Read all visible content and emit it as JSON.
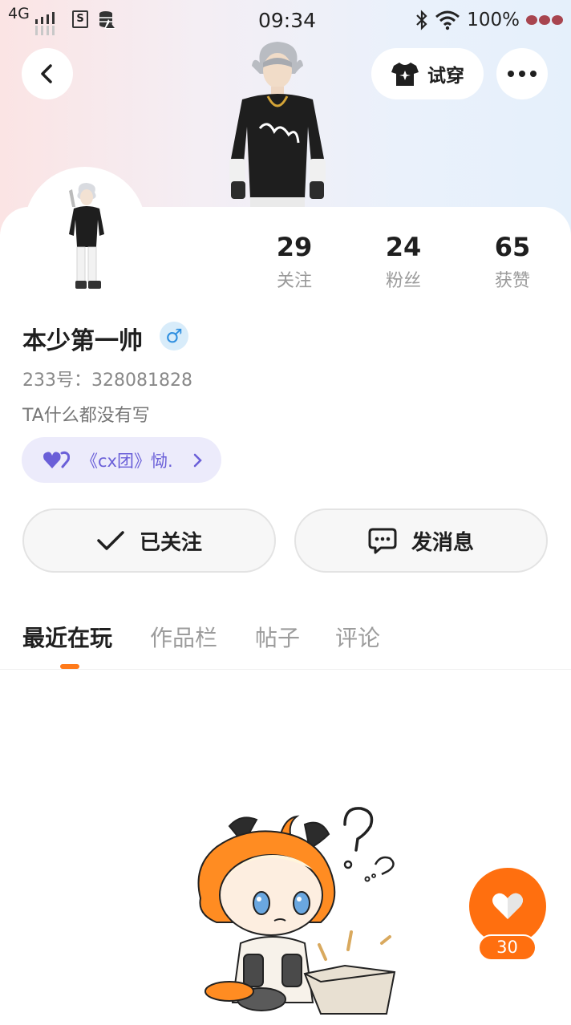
{
  "status_bar": {
    "network": "4G",
    "time": "09:34",
    "battery": "100%",
    "icons": [
      "signal-icon",
      "note-icon",
      "database-icon",
      "bluetooth-icon",
      "wifi-icon",
      "paw-icon"
    ]
  },
  "header": {
    "tryon_label": "试穿",
    "icons": [
      "back-icon",
      "tshirt-icon",
      "more-icon"
    ]
  },
  "profile": {
    "name": "本少第一帅",
    "gender_symbol": "♂",
    "uid": "233号：328081828",
    "bio": "TA什么都没有写",
    "group_label": "《cx团》恸.",
    "stats": [
      {
        "num": "29",
        "label": "关注"
      },
      {
        "num": "24",
        "label": "粉丝"
      },
      {
        "num": "65",
        "label": "获赞"
      }
    ]
  },
  "actions": {
    "follow_label": "已关注",
    "message_label": "发消息"
  },
  "tabs": [
    {
      "label": "最近在玩",
      "active": true
    },
    {
      "label": "作品栏",
      "active": false
    },
    {
      "label": "帖子",
      "active": false
    },
    {
      "label": "评论",
      "active": false
    }
  ],
  "like": {
    "count": "30"
  },
  "colors": {
    "accent": "#ff6f0f",
    "group_pill_bg": "#ecebfb",
    "group_text": "#6a5fd8",
    "gender_bg": "#d8ecfa",
    "gender_fg": "#2f8fe0"
  }
}
